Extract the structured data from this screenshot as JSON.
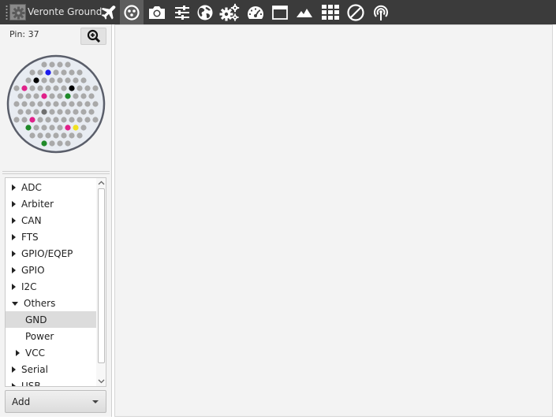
{
  "toolbar": {
    "app_title": "Veronte Ground",
    "app_icon": "gear-icon",
    "buttons": [
      {
        "name": "plane-icon",
        "active": false
      },
      {
        "name": "connector-icon",
        "active": true
      },
      {
        "name": "camera-icon",
        "active": false
      },
      {
        "name": "sliders-icon",
        "active": false
      },
      {
        "name": "globe-icon",
        "active": false
      },
      {
        "name": "gears-icon",
        "active": false
      },
      {
        "name": "gauge-icon",
        "active": false
      },
      {
        "name": "window-icon",
        "active": false
      },
      {
        "name": "mountain-icon",
        "active": false
      },
      {
        "name": "grid-icon",
        "active": false
      },
      {
        "name": "disabled-icon",
        "active": false
      },
      {
        "name": "antenna-icon",
        "active": false
      }
    ]
  },
  "pin_panel": {
    "pin_label": "Pin: 37",
    "zoom_icon": "zoom-in-icon",
    "colors": {
      "pin_default": "#a9a9a9",
      "pin_gnd": "#e0218a",
      "pin_blue": "#1a1aee",
      "pin_green": "#1f8a2a",
      "pin_black": "#000000",
      "pin_red": "#cc1111",
      "pin_yellow": "#f0e020",
      "pin_grey_selected": "#707070",
      "ring_border": "#5a5e6a",
      "ring_fill": "#e8ecf2"
    }
  },
  "tree": {
    "items": [
      {
        "label": "ADC",
        "state": "collapsed",
        "level": 0,
        "selected": false
      },
      {
        "label": "Arbiter",
        "state": "collapsed",
        "level": 0,
        "selected": false
      },
      {
        "label": "CAN",
        "state": "collapsed",
        "level": 0,
        "selected": false
      },
      {
        "label": "FTS",
        "state": "collapsed",
        "level": 0,
        "selected": false
      },
      {
        "label": "GPIO/EQEP",
        "state": "collapsed",
        "level": 0,
        "selected": false
      },
      {
        "label": "GPIO",
        "state": "collapsed",
        "level": 0,
        "selected": false
      },
      {
        "label": "I2C",
        "state": "collapsed",
        "level": 0,
        "selected": false
      },
      {
        "label": "Others",
        "state": "expanded",
        "level": 0,
        "selected": false
      },
      {
        "label": "GND",
        "state": "leaf",
        "level": 1,
        "selected": true
      },
      {
        "label": "Power",
        "state": "leaf",
        "level": 1,
        "selected": false
      },
      {
        "label": "VCC",
        "state": "collapsed",
        "level": 1,
        "selected": false
      },
      {
        "label": "Serial",
        "state": "collapsed",
        "level": 0,
        "selected": false
      },
      {
        "label": "USB",
        "state": "collapsed",
        "level": 0,
        "selected": false
      }
    ]
  },
  "add_select": {
    "label": "Add"
  }
}
